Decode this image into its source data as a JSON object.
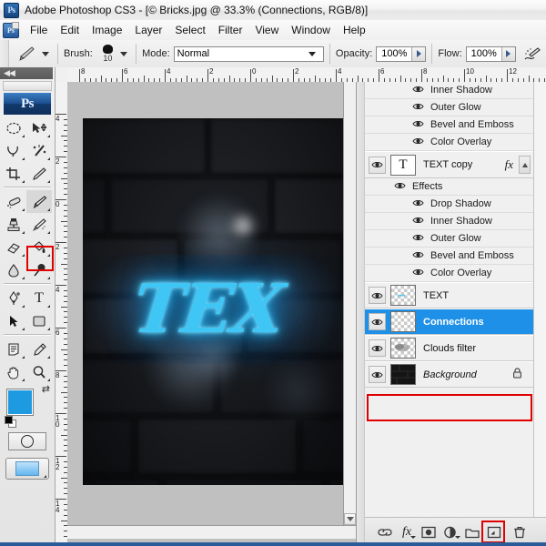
{
  "app": {
    "title": "Adobe Photoshop CS3 - [© Bricks.jpg @ 33.3% (Connections, RGB/8)]",
    "logo_text": "Ps",
    "accent_blue": "#1e90e8",
    "highlight_red": "#e00000",
    "neon_color": "#3fc6f5"
  },
  "menubar": {
    "icon": "ps-document-icon",
    "items": [
      {
        "label": "File"
      },
      {
        "label": "Edit"
      },
      {
        "label": "Image"
      },
      {
        "label": "Layer"
      },
      {
        "label": "Select"
      },
      {
        "label": "Filter"
      },
      {
        "label": "View"
      },
      {
        "label": "Window"
      },
      {
        "label": "Help"
      }
    ]
  },
  "options_bar": {
    "tool_icon": "brush-tool-icon",
    "brush_label": "Brush:",
    "brush_size": "10",
    "mode_label": "Mode:",
    "mode_value": "Normal",
    "opacity_label": "Opacity:",
    "opacity_value": "100%",
    "flow_label": "Flow:",
    "flow_value": "100%",
    "airbrush_icon": "airbrush-icon"
  },
  "toolbox": {
    "collapse_icon": "double-left-arrow-icon",
    "logo": "Ps",
    "selected_tool": "brush-tool",
    "tools": [
      {
        "name": "elliptical-marquee-tool",
        "glyph": "ellipse"
      },
      {
        "name": "move-tool",
        "glyph": "arrow-move"
      },
      {
        "name": "lasso-tool",
        "glyph": "lasso"
      },
      {
        "name": "magic-wand-tool",
        "glyph": "wand"
      },
      {
        "name": "crop-tool",
        "glyph": "crop"
      },
      {
        "name": "slice-tool",
        "glyph": "knife"
      },
      {
        "name": "healing-brush-tool",
        "glyph": "bandage"
      },
      {
        "name": "brush-tool",
        "glyph": "brush"
      },
      {
        "name": "clone-stamp-tool",
        "glyph": "stamp"
      },
      {
        "name": "history-brush-tool",
        "glyph": "history-brush"
      },
      {
        "name": "eraser-tool",
        "glyph": "eraser"
      },
      {
        "name": "paint-bucket-tool",
        "glyph": "bucket"
      },
      {
        "name": "blur-tool",
        "glyph": "droplet"
      },
      {
        "name": "dodge-tool",
        "glyph": "dodge"
      },
      {
        "name": "pen-tool",
        "glyph": "pen"
      },
      {
        "name": "type-tool",
        "glyph": "T"
      },
      {
        "name": "path-selection-tool",
        "glyph": "black-arrow"
      },
      {
        "name": "rectangle-shape-tool",
        "glyph": "rounded-rect"
      },
      {
        "name": "notes-tool",
        "glyph": "note"
      },
      {
        "name": "eyedropper-tool",
        "glyph": "eyedropper"
      },
      {
        "name": "hand-tool",
        "glyph": "hand"
      },
      {
        "name": "zoom-tool",
        "glyph": "magnifier"
      }
    ],
    "foreground_color": "#1e9be0",
    "background_color": "#ffffff",
    "swap_icon": "swap-colors-icon",
    "default_colors_icon": "default-colors-icon",
    "quickmask_icon": "quick-mask-icon",
    "screenmode_icon": "screen-mode-icon"
  },
  "rulers": {
    "unit": "inches",
    "horizontal_labels": [
      "8",
      "6",
      "4",
      "2",
      "0",
      "2",
      "4",
      "6",
      "8",
      "10",
      "12"
    ],
    "vertical_labels": [
      "4",
      "2",
      "0",
      "2",
      "4",
      "6",
      "8",
      "10",
      "12",
      "14"
    ]
  },
  "document": {
    "zoom": "33.3%",
    "filename": "© Bricks.jpg",
    "color_mode": "RGB/8",
    "active_layer": "Connections",
    "neon_text": "TEX"
  },
  "layers_panel": {
    "top_effects": [
      {
        "label": "Inner Shadow",
        "icon": "eye-icon"
      },
      {
        "label": "Outer Glow",
        "icon": "eye-icon"
      },
      {
        "label": "Bevel and Emboss",
        "icon": "eye-icon"
      },
      {
        "label": "Color Overlay",
        "icon": "eye-icon"
      }
    ],
    "text_copy_layer": {
      "name": "TEXT copy",
      "thumb": "type-layer-thumbnail",
      "thumb_glyph": "T",
      "fx_badge": "fx",
      "visible": true,
      "collapse_icon": "collapse-triangle-up-icon"
    },
    "effects_group_label": "Effects",
    "effects": [
      {
        "label": "Drop Shadow",
        "icon": "eye-icon"
      },
      {
        "label": "Inner Shadow",
        "icon": "eye-icon"
      },
      {
        "label": "Outer Glow",
        "icon": "eye-icon"
      },
      {
        "label": "Bevel and Emboss",
        "icon": "eye-icon"
      },
      {
        "label": "Color Overlay",
        "icon": "eye-icon"
      }
    ],
    "layers": [
      {
        "name": "TEXT",
        "visible": true,
        "thumb": "transparent-thumbnail",
        "selected": false,
        "locked": false,
        "italic": false
      },
      {
        "name": "Connections",
        "visible": true,
        "thumb": "transparent-thumbnail",
        "selected": true,
        "locked": false,
        "italic": false
      },
      {
        "name": "Clouds filter",
        "visible": true,
        "thumb": "transparent-thumbnail",
        "selected": false,
        "locked": false,
        "italic": false
      },
      {
        "name": "Background",
        "visible": true,
        "thumb": "dark-thumbnail",
        "selected": false,
        "locked": true,
        "italic": true
      }
    ],
    "bottom_buttons": [
      {
        "name": "link-layers-button",
        "icon": "chain-link-icon",
        "highlighted": false
      },
      {
        "name": "layer-style-button",
        "icon": "fx-icon",
        "highlighted": false
      },
      {
        "name": "layer-mask-button",
        "icon": "mask-circle-icon",
        "highlighted": false
      },
      {
        "name": "adjustment-layer-button",
        "icon": "half-circle-icon",
        "highlighted": false
      },
      {
        "name": "new-group-button",
        "icon": "folder-icon",
        "highlighted": false
      },
      {
        "name": "new-layer-button",
        "icon": "new-layer-icon",
        "highlighted": true
      },
      {
        "name": "delete-layer-button",
        "icon": "trash-icon",
        "highlighted": false
      }
    ]
  }
}
